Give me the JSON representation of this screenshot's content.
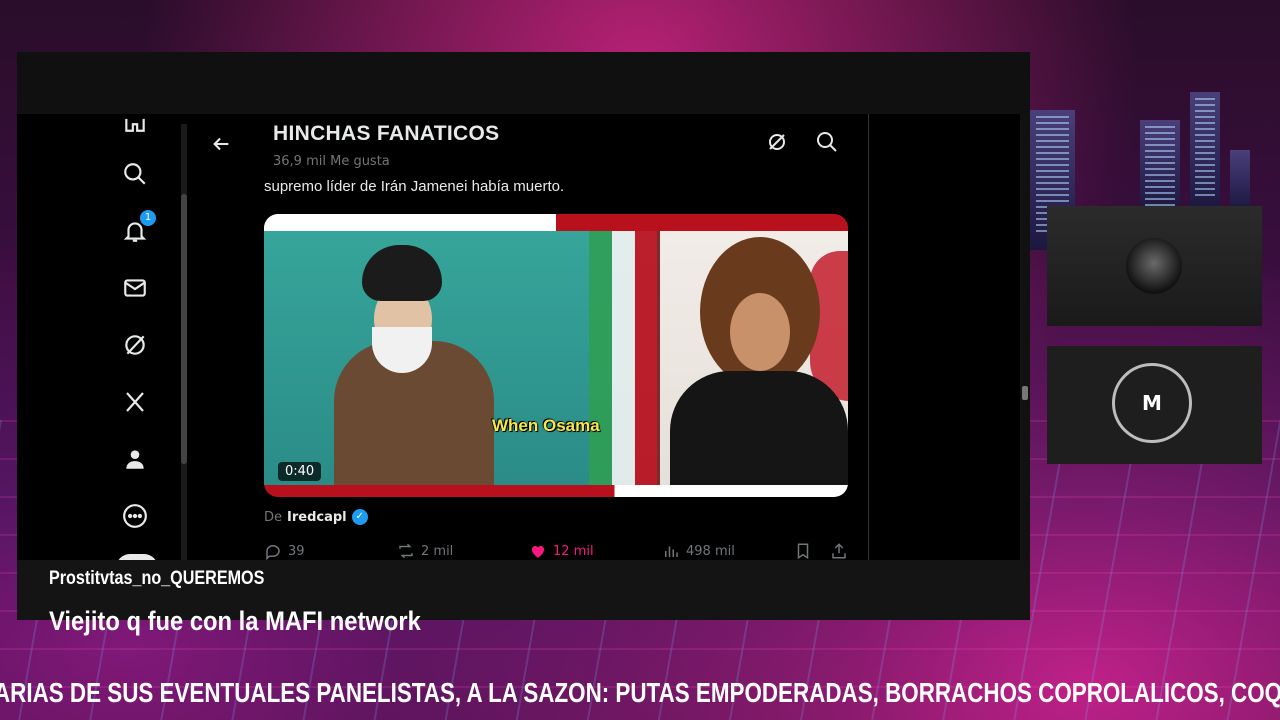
{
  "feed": {
    "title": "HINCHAS FANATICOS",
    "subtitle": "36,9 mil Me gusta",
    "tweet_text": "supremo líder de Irán Jamenei había muerto.",
    "media": {
      "caption": "When Osama",
      "duration": "0:40"
    },
    "from_prefix": "De",
    "from_handle": "Iredcapl",
    "actions": {
      "replies": "39",
      "reposts": "2 mil",
      "likes": "12 mil",
      "views": "498 mil"
    }
  },
  "nav": {
    "notifications_badge": "1",
    "icons": [
      "home-icon",
      "search-icon",
      "bell-icon",
      "mail-icon",
      "grok-icon",
      "x-logo-icon",
      "profile-icon",
      "more-icon"
    ]
  },
  "overlay": {
    "username": "Prostitvtas_no_QUEREMOS",
    "message": "Viejito q fue con la MAFI network",
    "ticker": "ARIAS DE SUS EVENTUALES PANELISTAS, A LA SAZON: PUTAS EMPODERADAS, BORRACHOS COPROLALICOS, COQUEROS R"
  },
  "participants": {
    "tile_b_initial": "M"
  },
  "colors": {
    "accent": "#1d9bf0",
    "like": "#f91880",
    "text": "#e7e9ea",
    "muted": "#71767b"
  }
}
